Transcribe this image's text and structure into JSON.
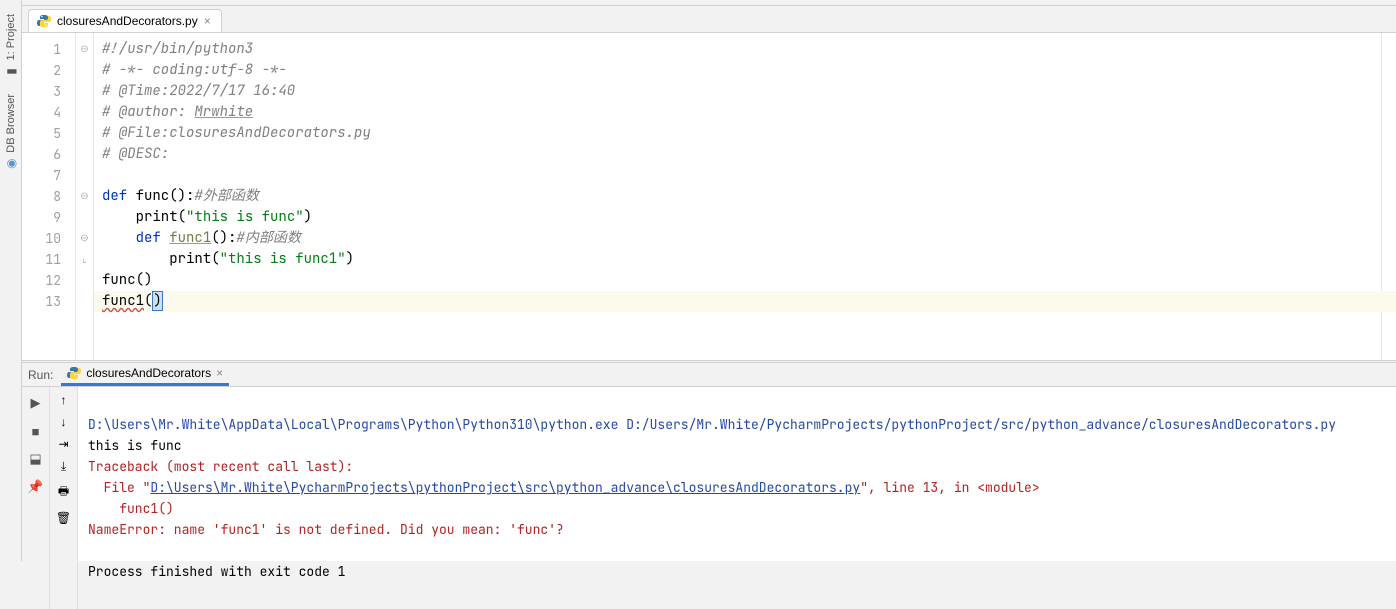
{
  "leftRail": {
    "project": "1: Project",
    "dbBrowser": "DB Browser"
  },
  "fileTab": {
    "name": "closuresAndDecorators.py",
    "close": "×"
  },
  "code": {
    "l1": "#!/usr/bin/python3",
    "l2": "# -*- coding:utf-8 -*-",
    "l3": "# @Time:2022/7/17 16:40",
    "l4_a": "# @author: ",
    "l4_b": "Mrwhite",
    "l5": "# @File:closuresAndDecorators.py",
    "l6": "# @DESC:",
    "l7": "",
    "kw_def": "def ",
    "fn_func": "func",
    "l8_paren": "():",
    "l8_c": "#外部函数",
    "indent1": "    ",
    "indent2": "        ",
    "print": "print",
    "l9_open": "(",
    "l9_str": "\"this is func\"",
    "l9_close": ")",
    "fn_func1": "func1",
    "l10_paren": "():",
    "l10_c": "#内部函数",
    "l11_str": "\"this is func1\"",
    "l12": "func()",
    "l13_a": "func1",
    "l13_b": "(",
    "l13_c": ")"
  },
  "lineNumbers": [
    "1",
    "2",
    "3",
    "4",
    "5",
    "6",
    "7",
    "8",
    "9",
    "10",
    "11",
    "12",
    "13"
  ],
  "run": {
    "label": "Run:",
    "tabName": "closuresAndDecorators",
    "tabClose": "×"
  },
  "console": {
    "l1": "D:\\Users\\Mr.White\\AppData\\Local\\Programs\\Python\\Python310\\python.exe D:/Users/Mr.White/PycharmProjects/pythonProject/src/python_advance/closuresAndDecorators.py",
    "l2": "this is func",
    "l3": "Traceback (most recent call last):",
    "l4_a": "  File \"",
    "l4_b": "D:\\Users\\Mr.White\\PycharmProjects\\pythonProject\\src\\python_advance\\closuresAndDecorators.py",
    "l4_c": "\", line 13, in <module>",
    "l5": "    func1()",
    "l6": "NameError: name 'func1' is not defined. Did you mean: 'func'?",
    "l7": "",
    "l8": "Process finished with exit code 1"
  }
}
